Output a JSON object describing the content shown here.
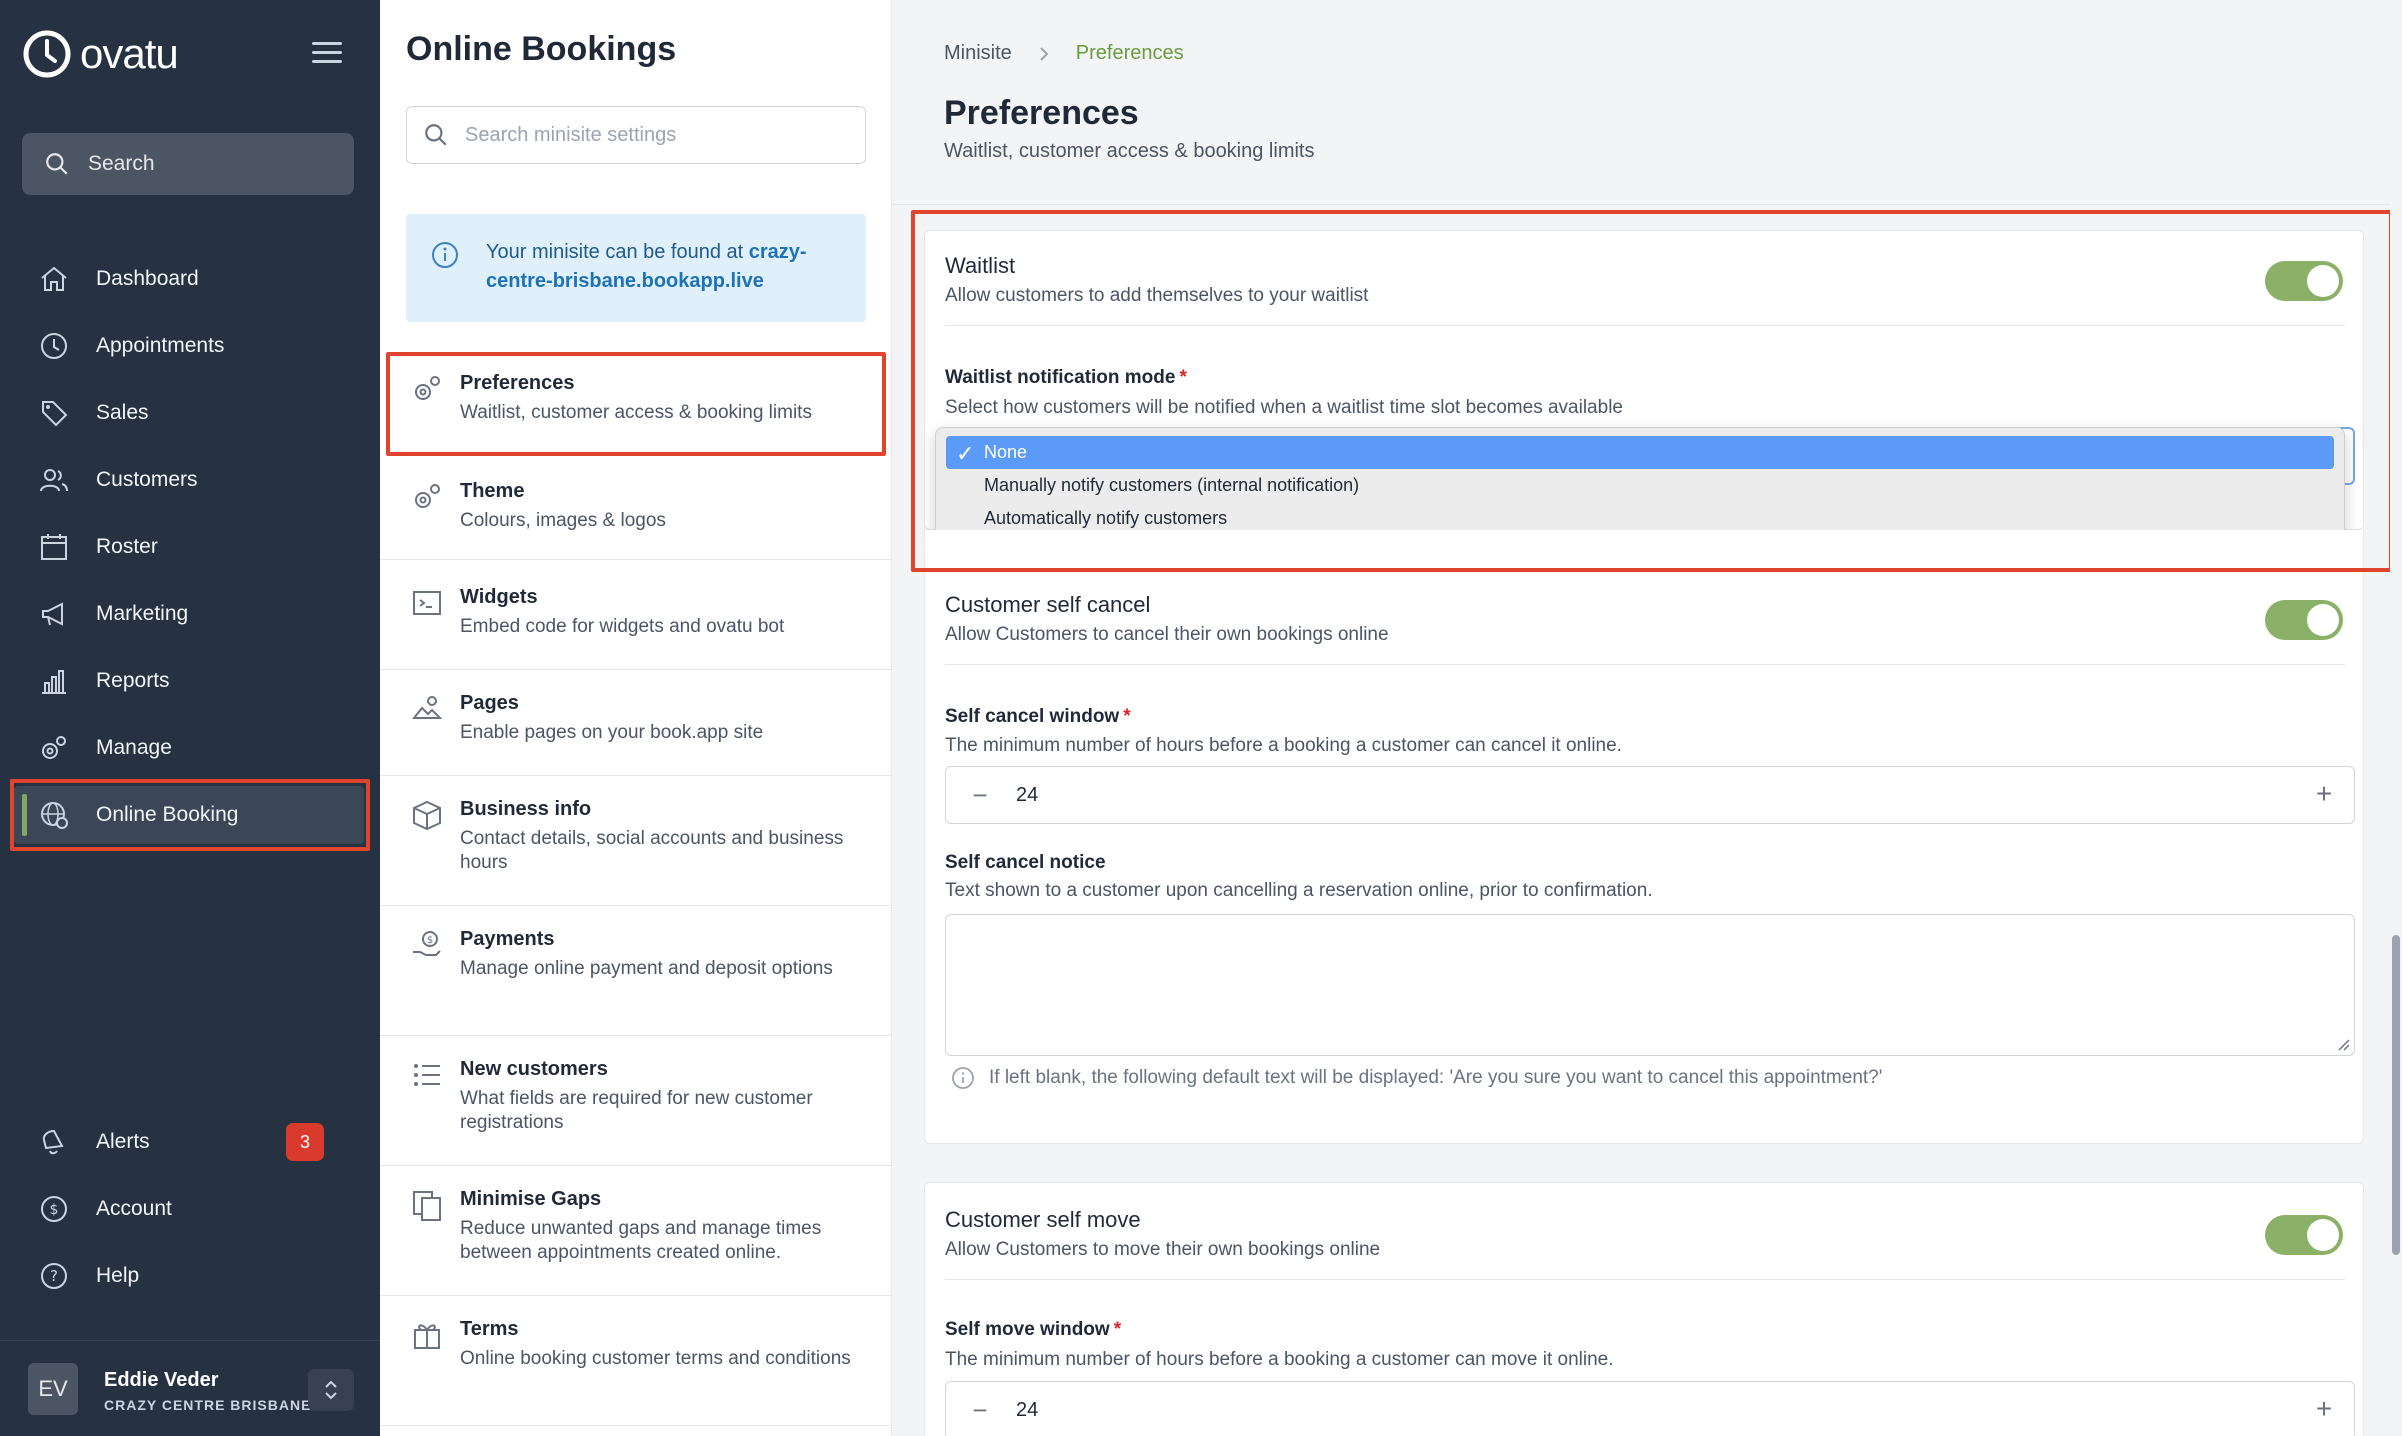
{
  "app": {
    "logo_text": "ovatu",
    "search_label": "Search"
  },
  "nav": {
    "items": [
      {
        "label": "Dashboard",
        "icon": "home-icon"
      },
      {
        "label": "Appointments",
        "icon": "clock-icon"
      },
      {
        "label": "Sales",
        "icon": "tag-icon"
      },
      {
        "label": "Customers",
        "icon": "users-icon"
      },
      {
        "label": "Roster",
        "icon": "calendar-icon"
      },
      {
        "label": "Marketing",
        "icon": "megaphone-icon"
      },
      {
        "label": "Reports",
        "icon": "bar-chart-icon"
      },
      {
        "label": "Manage",
        "icon": "gears-icon"
      },
      {
        "label": "Online Booking",
        "icon": "globe-gear-icon"
      }
    ],
    "bottom": [
      {
        "label": "Alerts",
        "icon": "bell-icon",
        "badge": "3"
      },
      {
        "label": "Account",
        "icon": "account-icon"
      },
      {
        "label": "Help",
        "icon": "help-icon"
      }
    ],
    "user": {
      "initials": "EV",
      "name": "Eddie Veder",
      "org": "CRAZY CENTRE BRISBANE"
    }
  },
  "settings_panel": {
    "title": "Online Bookings",
    "search_placeholder": "Search minisite settings",
    "info_prefix": "Your minisite can be found at ",
    "info_link": "crazy-centre-brisbane.bookapp.live",
    "items": [
      {
        "title": "Preferences",
        "sub": "Waitlist, customer access & booking limits",
        "icon": "gears-icon"
      },
      {
        "title": "Theme",
        "sub": "Colours, images & logos",
        "icon": "gears-icon"
      },
      {
        "title": "Widgets",
        "sub": "Embed code for widgets and ovatu bot",
        "icon": "code-icon"
      },
      {
        "title": "Pages",
        "sub": "Enable pages on your book.app site",
        "icon": "pages-icon"
      },
      {
        "title": "Business info",
        "sub": "Contact details, social accounts and business hours",
        "icon": "box-icon"
      },
      {
        "title": "Payments",
        "sub": "Manage online payment and deposit options",
        "icon": "payment-icon"
      },
      {
        "title": "New customers",
        "sub": "What fields are required for new customer registrations",
        "icon": "list-icon"
      },
      {
        "title": "Minimise Gaps",
        "sub": "Reduce unwanted gaps and manage times between appointments created online.",
        "icon": "copy-icon"
      },
      {
        "title": "Terms",
        "sub": "Online booking customer terms and conditions",
        "icon": "gift-icon"
      }
    ]
  },
  "breadcrumb": {
    "parent": "Minisite",
    "current": "Preferences"
  },
  "page": {
    "title": "Preferences",
    "subtitle": "Waitlist, customer access & booking limits"
  },
  "waitlist": {
    "title": "Waitlist",
    "sub": "Allow customers to add themselves to your waitlist",
    "enabled": true,
    "mode_label": "Waitlist notification mode",
    "required_mark": "*",
    "mode_help": "Select how customers will be notified when a waitlist time slot becomes available",
    "options": [
      "None",
      "Manually notify customers (internal notification)",
      "Automatically notify customers"
    ],
    "selected": "None",
    "check": "✓"
  },
  "self_cancel": {
    "title": "Customer self cancel",
    "sub": "Allow Customers to cancel their own bookings online",
    "enabled": true,
    "window_label": "Self cancel window",
    "window_help": "The minimum number of hours before a booking a customer can cancel it online.",
    "window_value": "24",
    "notice_label": "Self cancel notice",
    "notice_help": "Text shown to a customer upon cancelling a reservation online, prior to confirmation.",
    "notice_hint": "If left blank, the following default text will be displayed: 'Are you sure you want to cancel this appointment?'"
  },
  "self_move": {
    "title": "Customer self move",
    "sub": "Allow Customers to move their own bookings online",
    "enabled": true,
    "window_label": "Self move window",
    "window_help": "The minimum number of hours before a booking a customer can move it online.",
    "window_value": "24"
  },
  "colors": {
    "accent_green": "#8bb067",
    "highlight_red": "#e0442e",
    "nav_bg": "#263141",
    "select_blue": "#5b9bf7"
  }
}
